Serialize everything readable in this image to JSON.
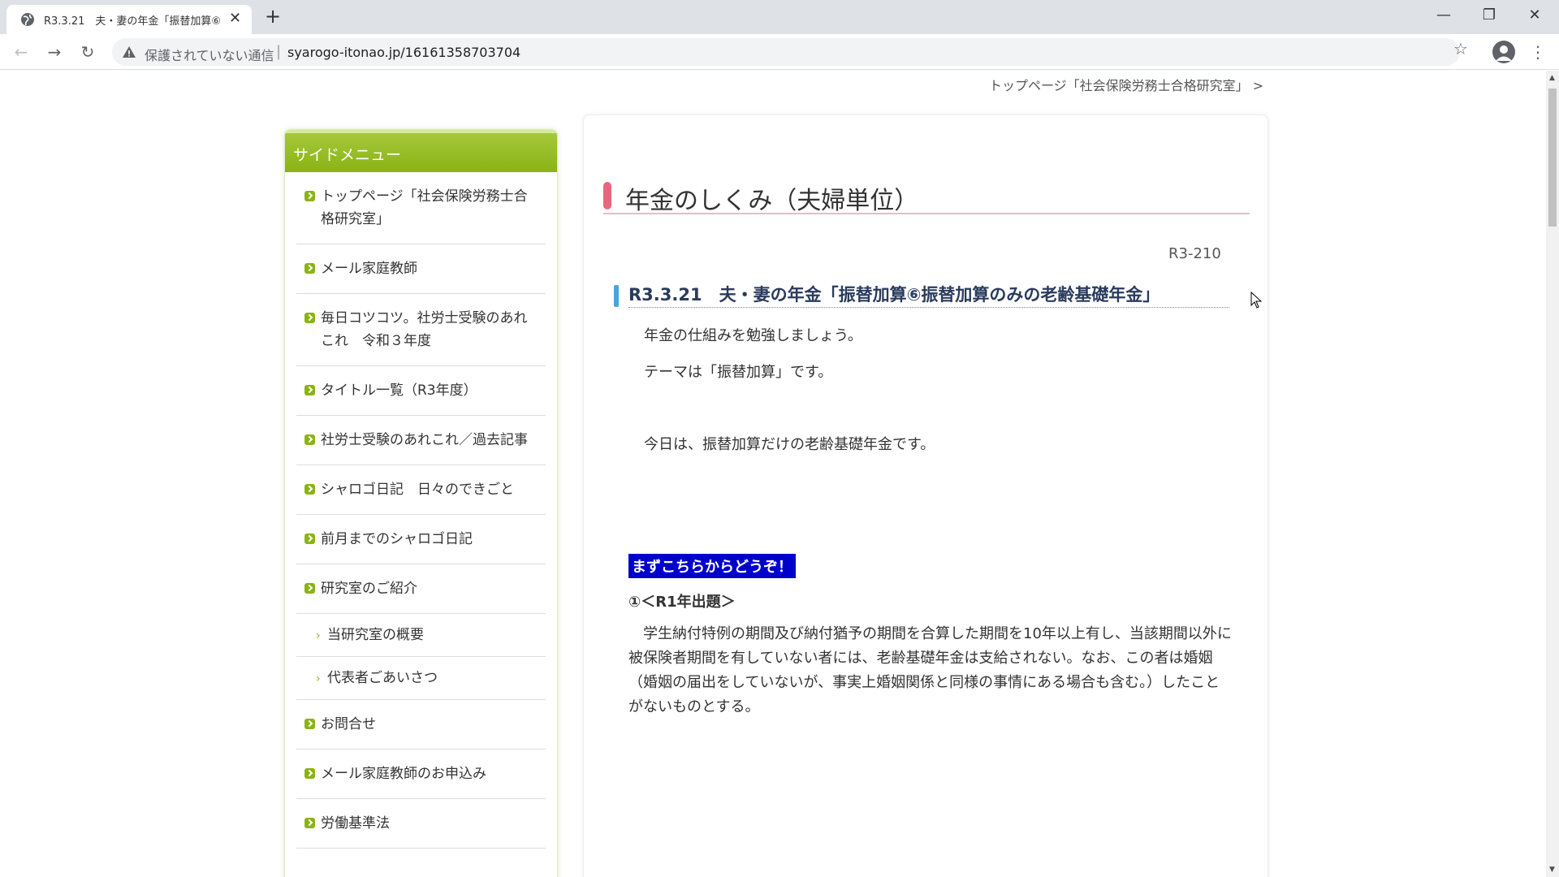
{
  "browser": {
    "tab_title": "R3.3.21　夫・妻の年金「振替加算⑥",
    "tab_close": "✕",
    "new_tab": "+",
    "window": {
      "minimize": "—",
      "restore": "❐",
      "close": "✕"
    },
    "nav": {
      "back": "←",
      "forward": "→",
      "reload": "↻"
    },
    "security_text": "保護されていない通信",
    "url_separator": "|",
    "url": "syarogo-itonao.jp/16161358703704",
    "bookmark_star": "☆",
    "menu": "⋮"
  },
  "page": {
    "breadcrumb": "トップページ「社会保険労務士合格研究室」 >",
    "sidemenu": {
      "header": "サイドメニュー",
      "items": [
        {
          "label": "トップページ「社会保険労務士合格研究室」"
        },
        {
          "label": "メール家庭教師"
        },
        {
          "label": "毎日コツコツ。社労士受験のあれこれ　令和３年度"
        },
        {
          "label": "タイトル一覧（R3年度）"
        },
        {
          "label": "社労士受験のあれこれ／過去記事"
        },
        {
          "label": "シャロゴ日記　日々のできごと"
        },
        {
          "label": "前月までのシャロゴ日記"
        },
        {
          "label": "研究室のご紹介"
        }
      ],
      "subitems": [
        {
          "label": "当研究室の概要"
        },
        {
          "label": "代表者ごあいさつ"
        }
      ],
      "items_after": [
        {
          "label": "お問合せ"
        },
        {
          "label": "メール家庭教師のお申込み"
        },
        {
          "label": "労働基準法"
        }
      ],
      "sub_arrow": "›"
    },
    "main": {
      "title": "年金のしくみ（夫婦単位）",
      "doc_code": "R3-210",
      "subtitle": "R3.3.21　夫・妻の年金「振替加算⑥振替加算のみの老齢基礎年金」",
      "para1": "年金の仕組みを勉強しましょう。",
      "para2": "テーマは「振替加算」です。",
      "para3": "今日は、振替加算だけの老齢基礎年金です。",
      "highlight": "まずこちらからどうぞ！",
      "question_head": "①＜R1年出題＞",
      "question_body": "　学生納付特例の期間及び納付猶予の期間を合算した期間を10年以上有し、当該期間以外に被保険者期間を有していない者には、老齢基礎年金は支給されない。なお、この者は婚姻（婚姻の届出をしていないが、事実上婚姻関係と同様の事情にある場合も含む。）したことがないものとする。"
    }
  }
}
